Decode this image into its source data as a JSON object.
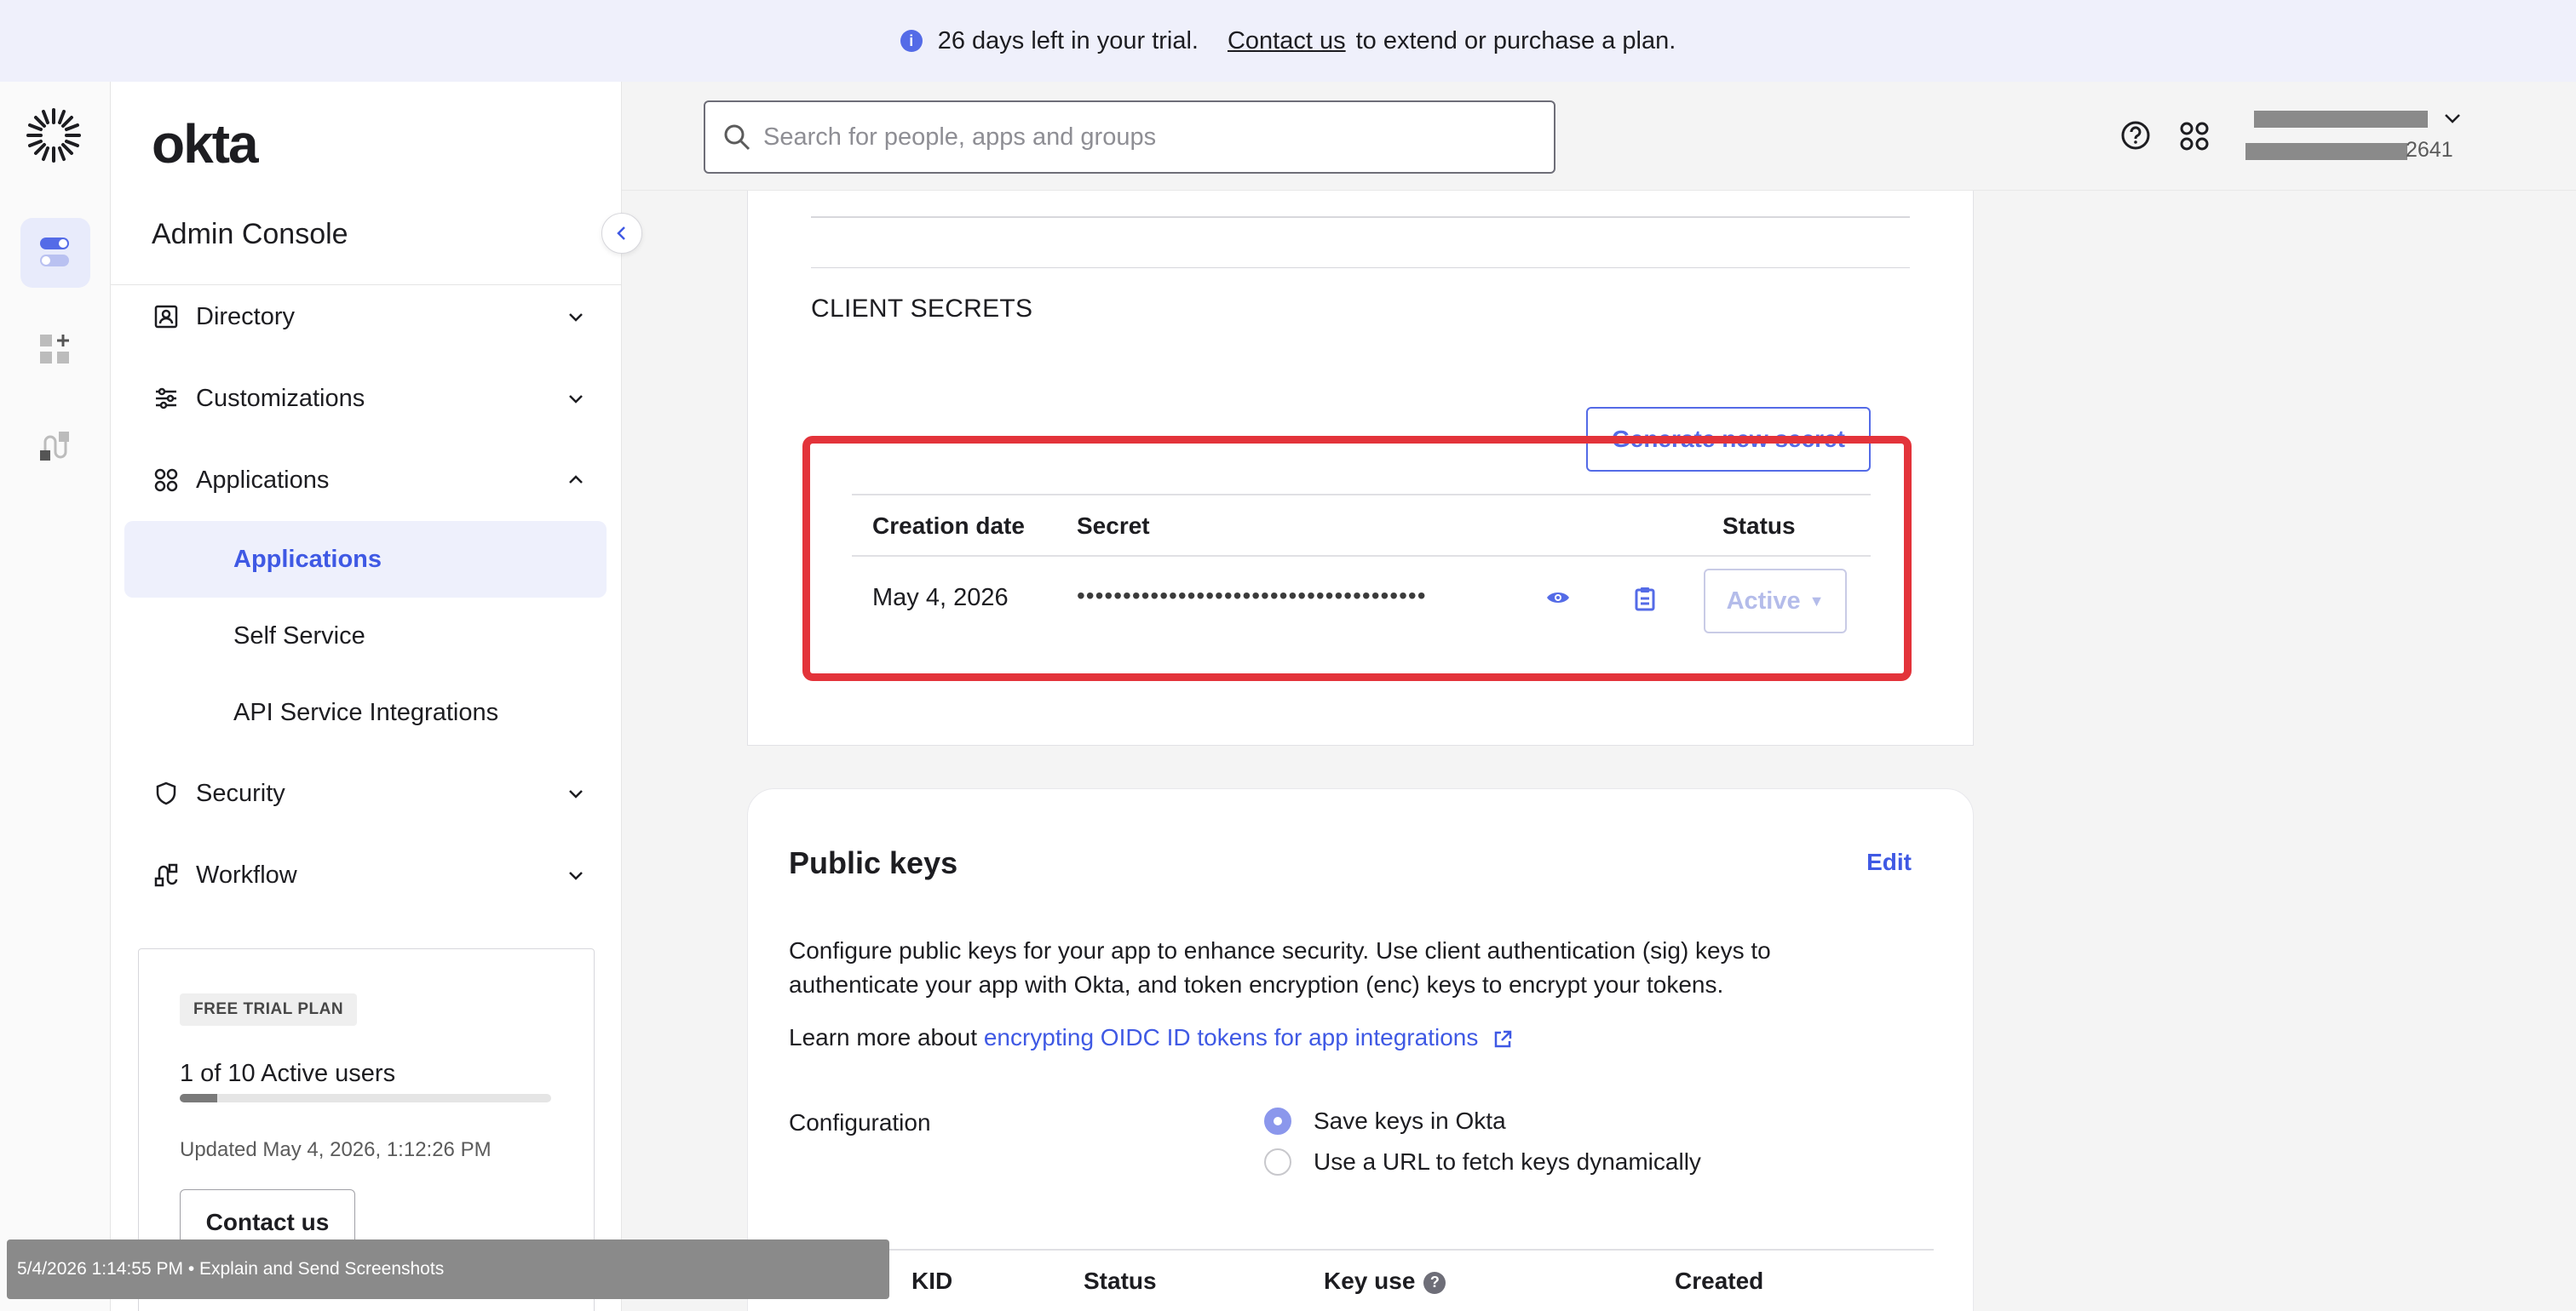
{
  "banner": {
    "message": "26 days left in your trial.",
    "link": "Contact us",
    "suffix": "to extend or purchase a plan."
  },
  "sidebar": {
    "wordmark": "okta",
    "console_title": "Admin Console",
    "nav": [
      {
        "label": "Directory"
      },
      {
        "label": "Customizations"
      },
      {
        "label": "Applications"
      },
      {
        "label": "Security"
      },
      {
        "label": "Workflow"
      }
    ],
    "sub_items": [
      {
        "label": "Applications",
        "active": true
      },
      {
        "label": "Self Service"
      },
      {
        "label": "API Service Integrations"
      }
    ],
    "trial": {
      "tag": "FREE TRIAL PLAN",
      "users": "1 of 10 Active users",
      "progress": 0.1,
      "updated": "Updated May 4, 2026, 1:12:26 PM",
      "contact_button": "Contact us"
    }
  },
  "header": {
    "search_placeholder": "Search for people, apps and groups",
    "org_suffix": "2641"
  },
  "client_secrets": {
    "section_title": "CLIENT SECRETS",
    "generate_button": "Generate new secret",
    "columns": [
      "Creation date",
      "Secret",
      "Status"
    ],
    "rows": [
      {
        "date": "May 4, 2026",
        "secret": "••••••••••••••••••••••••••••••••••••••",
        "status": "Active"
      }
    ]
  },
  "public_keys": {
    "title": "Public keys",
    "edit": "Edit",
    "description": "Configure public keys for your app to enhance security. Use client authentication (sig) keys to authenticate your app with Okta, and token encryption (enc) keys to encrypt your tokens.",
    "learn_prefix": "Learn more about",
    "learn_link": "encrypting OIDC ID tokens for app integrations",
    "config_label": "Configuration",
    "options": [
      "Save keys in Okta",
      "Use a URL to fetch keys dynamically"
    ],
    "columns": [
      "KID",
      "Status",
      "Key use",
      "Created"
    ]
  },
  "toast": "5/4/2026 1:14:55 PM • Explain and Send Screenshots",
  "colors": {
    "accent": "#546be7",
    "highlight": "#e3333a",
    "banner_bg": "#eff0fb"
  }
}
